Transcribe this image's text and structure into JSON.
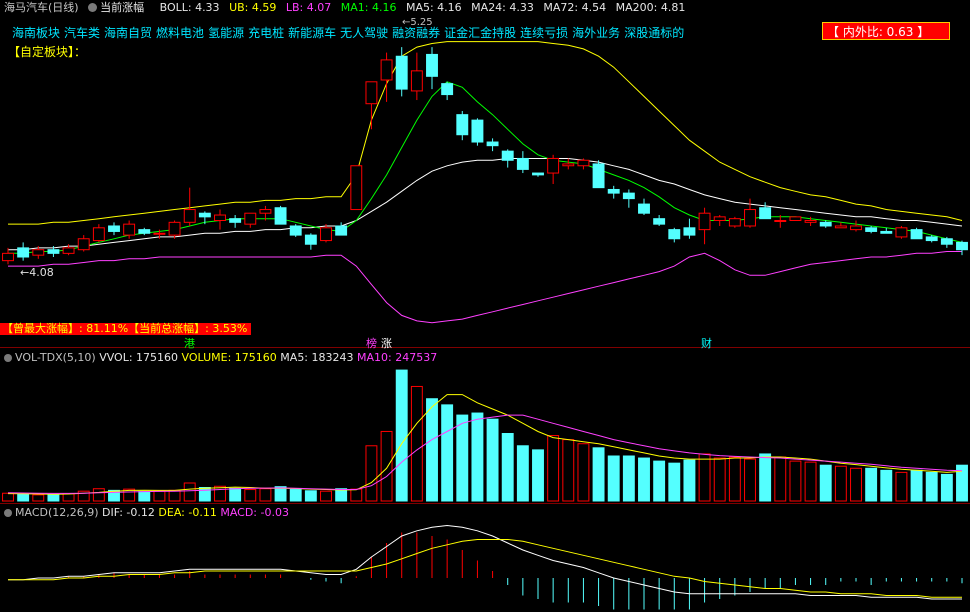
{
  "header": {
    "stock_name": "海马汽车(日线)",
    "indicator_name": "当前涨幅",
    "boll_label": "BOLL: 4.33",
    "ub_label": "UB: 4.59",
    "lb_label": "LB: 4.07",
    "ma1_label": "MA1: 4.16",
    "ma5_label": "MA5: 4.16",
    "ma24_label": "MA24: 4.33",
    "ma72_label": "MA72: 4.54",
    "ma200_label": "MA200: 4.81"
  },
  "concepts": [
    "海南板块",
    "汽车类",
    "海南自贸",
    "燃料电池",
    "氢能源",
    "充电桩",
    "新能源车",
    "无人驾驶",
    "融资融券",
    "证金汇金持股",
    "连续亏损",
    "海外业务",
    "深股通标的"
  ],
  "self_block_label": "【自定板块】：",
  "ratio_box": {
    "label": "【 内外比: 0.63 】"
  },
  "stats_bar": "【曾最大涨幅】: 81.11%【当前总涨幅】: 3.53%",
  "price_high_label": "5.25",
  "price_low_label": "←4.08",
  "events": [
    {
      "label": "港",
      "color": "#00ff00"
    },
    {
      "label": "榜",
      "color": "#ff40ff"
    },
    {
      "label": "涨",
      "color": "#ffffff"
    },
    {
      "label": "财",
      "color": "#00ffff"
    }
  ],
  "volume_header": {
    "title": "VOL-TDX(5,10)",
    "vvol": "VVOL: 175160",
    "volume": "VOLUME: 175160",
    "ma5": "MA5: 183243",
    "ma10": "MA10: 247537"
  },
  "macd_header": {
    "title": "MACD(12,26,9)",
    "dif": "DIF: -0.12",
    "dea": "DEA: -0.11",
    "macd": "MACD: -0.03"
  },
  "colors": {
    "up": "#ff0000",
    "down": "#54ffff",
    "ma_white": "#ffffff",
    "ma_yellow": "#ffff00",
    "ma_green": "#00ff00",
    "ma_magenta": "#ff40ff",
    "grid_red": "#800000"
  },
  "chart_data": [
    {
      "type": "candlestick",
      "title": "海马汽车(日线)",
      "ylim": [
        3.7,
        5.3
      ],
      "high_marker": 5.25,
      "low_marker": 4.08,
      "candles": [
        {
          "o": 4.08,
          "h": 4.15,
          "l": 4.06,
          "c": 4.12
        },
        {
          "o": 4.15,
          "h": 4.18,
          "l": 4.08,
          "c": 4.1
        },
        {
          "o": 4.11,
          "h": 4.16,
          "l": 4.09,
          "c": 4.14
        },
        {
          "o": 4.14,
          "h": 4.16,
          "l": 4.1,
          "c": 4.12
        },
        {
          "o": 4.12,
          "h": 4.17,
          "l": 4.11,
          "c": 4.15
        },
        {
          "o": 4.14,
          "h": 4.22,
          "l": 4.13,
          "c": 4.2
        },
        {
          "o": 4.19,
          "h": 4.28,
          "l": 4.18,
          "c": 4.26
        },
        {
          "o": 4.27,
          "h": 4.29,
          "l": 4.22,
          "c": 4.24
        },
        {
          "o": 4.22,
          "h": 4.3,
          "l": 4.2,
          "c": 4.28
        },
        {
          "o": 4.25,
          "h": 4.26,
          "l": 4.22,
          "c": 4.23
        },
        {
          "o": 4.23,
          "h": 4.25,
          "l": 4.2,
          "c": 4.23
        },
        {
          "o": 4.22,
          "h": 4.3,
          "l": 4.2,
          "c": 4.29
        },
        {
          "o": 4.29,
          "h": 4.48,
          "l": 4.27,
          "c": 4.36
        },
        {
          "o": 4.34,
          "h": 4.35,
          "l": 4.28,
          "c": 4.32
        },
        {
          "o": 4.3,
          "h": 4.36,
          "l": 4.25,
          "c": 4.33
        },
        {
          "o": 4.31,
          "h": 4.33,
          "l": 4.26,
          "c": 4.29
        },
        {
          "o": 4.28,
          "h": 4.34,
          "l": 4.26,
          "c": 4.34
        },
        {
          "o": 4.34,
          "h": 4.38,
          "l": 4.3,
          "c": 4.36
        },
        {
          "o": 4.37,
          "h": 4.38,
          "l": 4.28,
          "c": 4.28
        },
        {
          "o": 4.27,
          "h": 4.28,
          "l": 4.21,
          "c": 4.22
        },
        {
          "o": 4.22,
          "h": 4.23,
          "l": 4.14,
          "c": 4.17
        },
        {
          "o": 4.19,
          "h": 4.28,
          "l": 4.18,
          "c": 4.26
        },
        {
          "o": 4.27,
          "h": 4.29,
          "l": 4.22,
          "c": 4.22
        },
        {
          "o": 4.36,
          "h": 4.6,
          "l": 4.36,
          "c": 4.6
        },
        {
          "o": 4.94,
          "h": 5.06,
          "l": 4.8,
          "c": 5.06
        },
        {
          "o": 5.07,
          "h": 5.22,
          "l": 4.95,
          "c": 5.18
        },
        {
          "o": 5.2,
          "h": 5.25,
          "l": 4.98,
          "c": 5.02
        },
        {
          "o": 5.01,
          "h": 5.22,
          "l": 4.96,
          "c": 5.12
        },
        {
          "o": 5.21,
          "h": 5.25,
          "l": 5.02,
          "c": 5.09
        },
        {
          "o": 5.05,
          "h": 5.06,
          "l": 4.96,
          "c": 4.99
        },
        {
          "o": 4.88,
          "h": 4.9,
          "l": 4.74,
          "c": 4.77
        },
        {
          "o": 4.85,
          "h": 4.86,
          "l": 4.71,
          "c": 4.73
        },
        {
          "o": 4.73,
          "h": 4.75,
          "l": 4.68,
          "c": 4.71
        },
        {
          "o": 4.68,
          "h": 4.69,
          "l": 4.59,
          "c": 4.63
        },
        {
          "o": 4.64,
          "h": 4.68,
          "l": 4.56,
          "c": 4.58
        },
        {
          "o": 4.56,
          "h": 4.56,
          "l": 4.54,
          "c": 4.55
        },
        {
          "o": 4.56,
          "h": 4.66,
          "l": 4.5,
          "c": 4.64
        },
        {
          "o": 4.6,
          "h": 4.64,
          "l": 4.58,
          "c": 4.61
        },
        {
          "o": 4.6,
          "h": 4.64,
          "l": 4.58,
          "c": 4.63
        },
        {
          "o": 4.61,
          "h": 4.63,
          "l": 4.48,
          "c": 4.48
        },
        {
          "o": 4.47,
          "h": 4.49,
          "l": 4.42,
          "c": 4.45
        },
        {
          "o": 4.45,
          "h": 4.47,
          "l": 4.37,
          "c": 4.42
        },
        {
          "o": 4.39,
          "h": 4.42,
          "l": 4.33,
          "c": 4.34
        },
        {
          "o": 4.31,
          "h": 4.33,
          "l": 4.27,
          "c": 4.28
        },
        {
          "o": 4.25,
          "h": 4.26,
          "l": 4.18,
          "c": 4.2
        },
        {
          "o": 4.26,
          "h": 4.31,
          "l": 4.2,
          "c": 4.22
        },
        {
          "o": 4.25,
          "h": 4.37,
          "l": 4.17,
          "c": 4.34
        },
        {
          "o": 4.3,
          "h": 4.33,
          "l": 4.27,
          "c": 4.32
        },
        {
          "o": 4.27,
          "h": 4.32,
          "l": 4.26,
          "c": 4.31
        },
        {
          "o": 4.27,
          "h": 4.42,
          "l": 4.26,
          "c": 4.36
        },
        {
          "o": 4.37,
          "h": 4.4,
          "l": 4.31,
          "c": 4.31
        },
        {
          "o": 4.3,
          "h": 4.33,
          "l": 4.26,
          "c": 4.3
        },
        {
          "o": 4.3,
          "h": 4.32,
          "l": 4.3,
          "c": 4.32
        },
        {
          "o": 4.29,
          "h": 4.32,
          "l": 4.27,
          "c": 4.3
        },
        {
          "o": 4.29,
          "h": 4.3,
          "l": 4.26,
          "c": 4.27
        },
        {
          "o": 4.26,
          "h": 4.29,
          "l": 4.26,
          "c": 4.27
        },
        {
          "o": 4.25,
          "h": 4.3,
          "l": 4.24,
          "c": 4.27
        },
        {
          "o": 4.26,
          "h": 4.27,
          "l": 4.23,
          "c": 4.24
        },
        {
          "o": 4.24,
          "h": 4.26,
          "l": 4.23,
          "c": 4.23
        },
        {
          "o": 4.21,
          "h": 4.27,
          "l": 4.2,
          "c": 4.26
        },
        {
          "o": 4.25,
          "h": 4.26,
          "l": 4.2,
          "c": 4.2
        },
        {
          "o": 4.21,
          "h": 4.22,
          "l": 4.18,
          "c": 4.19
        },
        {
          "o": 4.2,
          "h": 4.21,
          "l": 4.15,
          "c": 4.17
        },
        {
          "o": 4.18,
          "h": 4.19,
          "l": 4.11,
          "c": 4.14
        }
      ],
      "ma_short": [
        4.12,
        4.12,
        4.13,
        4.13,
        4.14,
        4.16,
        4.18,
        4.2,
        4.22,
        4.23,
        4.24,
        4.25,
        4.27,
        4.29,
        4.3,
        4.31,
        4.31,
        4.31,
        4.31,
        4.29,
        4.27,
        4.25,
        4.24,
        4.3,
        4.42,
        4.55,
        4.7,
        4.85,
        4.98,
        5.06,
        5.03,
        4.95,
        4.88,
        4.8,
        4.72,
        4.66,
        4.63,
        4.62,
        4.61,
        4.58,
        4.55,
        4.52,
        4.48,
        4.43,
        4.37,
        4.33,
        4.3,
        4.3,
        4.3,
        4.31,
        4.32,
        4.32,
        4.32,
        4.31,
        4.3,
        4.29,
        4.28,
        4.27,
        4.26,
        4.25,
        4.24,
        4.22,
        4.2,
        4.18
      ],
      "boll_mid": [
        4.14,
        4.14,
        4.15,
        4.15,
        4.16,
        4.16,
        4.17,
        4.18,
        4.19,
        4.2,
        4.21,
        4.21,
        4.22,
        4.23,
        4.23,
        4.24,
        4.24,
        4.25,
        4.25,
        4.26,
        4.26,
        4.27,
        4.27,
        4.3,
        4.35,
        4.4,
        4.46,
        4.52,
        4.57,
        4.6,
        4.62,
        4.63,
        4.63,
        4.64,
        4.64,
        4.64,
        4.64,
        4.64,
        4.63,
        4.62,
        4.6,
        4.58,
        4.55,
        4.52,
        4.5,
        4.47,
        4.44,
        4.42,
        4.4,
        4.39,
        4.38,
        4.37,
        4.36,
        4.35,
        4.34,
        4.33,
        4.32,
        4.32,
        4.31,
        4.3,
        4.3,
        4.29,
        4.28,
        4.27
      ],
      "boll_upper": [
        4.28,
        4.28,
        4.28,
        4.29,
        4.29,
        4.3,
        4.31,
        4.32,
        4.33,
        4.34,
        4.35,
        4.36,
        4.37,
        4.38,
        4.39,
        4.4,
        4.4,
        4.41,
        4.41,
        4.42,
        4.42,
        4.43,
        4.43,
        4.55,
        4.85,
        5.05,
        5.2,
        5.25,
        5.27,
        5.28,
        5.28,
        5.28,
        5.28,
        5.28,
        5.28,
        5.28,
        5.27,
        5.26,
        5.24,
        5.2,
        5.14,
        5.06,
        4.98,
        4.9,
        4.82,
        4.74,
        4.68,
        4.62,
        4.58,
        4.54,
        4.51,
        4.48,
        4.46,
        4.44,
        4.43,
        4.41,
        4.39,
        4.38,
        4.36,
        4.35,
        4.34,
        4.33,
        4.32,
        4.3
      ],
      "boll_lower": [
        4.05,
        4.05,
        4.05,
        4.06,
        4.06,
        4.07,
        4.08,
        4.08,
        4.09,
        4.09,
        4.1,
        4.1,
        4.1,
        4.1,
        4.1,
        4.1,
        4.1,
        4.1,
        4.1,
        4.1,
        4.1,
        4.11,
        4.11,
        4.05,
        3.95,
        3.85,
        3.78,
        3.75,
        3.74,
        3.75,
        3.76,
        3.78,
        3.8,
        3.82,
        3.84,
        3.86,
        3.88,
        3.9,
        3.92,
        3.94,
        3.96,
        3.98,
        4.0,
        4.02,
        4.05,
        4.1,
        4.12,
        4.08,
        4.03,
        4.0,
        4.0,
        4.02,
        4.04,
        4.06,
        4.07,
        4.08,
        4.09,
        4.1,
        4.1,
        4.11,
        4.12,
        4.12,
        4.13,
        4.13
      ]
    },
    {
      "type": "bar",
      "title": "VOL-TDX(5,10)",
      "volumes": [
        38,
        32,
        30,
        30,
        36,
        48,
        60,
        52,
        58,
        46,
        48,
        52,
        88,
        66,
        72,
        62,
        56,
        60,
        70,
        56,
        50,
        48,
        60,
        58,
        270,
        340,
        640,
        560,
        500,
        470,
        420,
        430,
        400,
        330,
        270,
        250,
        320,
        300,
        280,
        260,
        220,
        220,
        210,
        195,
        185,
        200,
        230,
        210,
        215,
        205,
        230,
        215,
        195,
        190,
        175,
        170,
        160,
        160,
        150,
        140,
        150,
        140,
        130,
        175
      ],
      "ma5": [
        36,
        35,
        34,
        33,
        34,
        38,
        42,
        48,
        52,
        53,
        52,
        52,
        58,
        62,
        65,
        68,
        66,
        62,
        62,
        61,
        58,
        56,
        54,
        55,
        90,
        160,
        280,
        380,
        460,
        520,
        520,
        480,
        450,
        420,
        380,
        340,
        310,
        300,
        290,
        280,
        265,
        250,
        235,
        220,
        210,
        205,
        205,
        205,
        210,
        210,
        215,
        215,
        210,
        205,
        195,
        185,
        178,
        170,
        162,
        155,
        150,
        145,
        140,
        145
      ],
      "ma10": [
        40,
        39,
        38,
        37,
        37,
        38,
        40,
        42,
        44,
        46,
        47,
        48,
        50,
        53,
        56,
        60,
        62,
        63,
        64,
        62,
        60,
        58,
        56,
        56,
        75,
        120,
        190,
        250,
        300,
        340,
        380,
        400,
        410,
        420,
        420,
        400,
        380,
        360,
        340,
        320,
        300,
        285,
        270,
        255,
        245,
        235,
        228,
        222,
        218,
        215,
        212,
        210,
        205,
        200,
        195,
        190,
        185,
        180,
        172,
        165,
        160,
        155,
        150,
        148
      ]
    },
    {
      "type": "line",
      "title": "MACD(12,26,9)",
      "dif": [
        -0.01,
        -0.01,
        0.0,
        0.0,
        0.01,
        0.01,
        0.02,
        0.03,
        0.03,
        0.03,
        0.03,
        0.04,
        0.05,
        0.05,
        0.05,
        0.05,
        0.05,
        0.05,
        0.05,
        0.04,
        0.03,
        0.02,
        0.02,
        0.05,
        0.12,
        0.18,
        0.24,
        0.27,
        0.29,
        0.3,
        0.29,
        0.27,
        0.24,
        0.2,
        0.16,
        0.13,
        0.1,
        0.08,
        0.06,
        0.03,
        0.0,
        -0.02,
        -0.04,
        -0.06,
        -0.08,
        -0.09,
        -0.09,
        -0.09,
        -0.09,
        -0.09,
        -0.09,
        -0.09,
        -0.09,
        -0.1,
        -0.1,
        -0.1,
        -0.1,
        -0.11,
        -0.11,
        -0.11,
        -0.11,
        -0.12,
        -0.12,
        -0.12
      ],
      "dea": [
        -0.01,
        -0.01,
        -0.01,
        -0.01,
        0.0,
        0.0,
        0.01,
        0.01,
        0.02,
        0.02,
        0.02,
        0.03,
        0.03,
        0.04,
        0.04,
        0.04,
        0.04,
        0.04,
        0.04,
        0.04,
        0.04,
        0.04,
        0.04,
        0.04,
        0.06,
        0.08,
        0.11,
        0.14,
        0.17,
        0.19,
        0.21,
        0.22,
        0.22,
        0.22,
        0.21,
        0.19,
        0.17,
        0.15,
        0.13,
        0.11,
        0.09,
        0.07,
        0.05,
        0.03,
        0.01,
        0.0,
        -0.02,
        -0.03,
        -0.04,
        -0.05,
        -0.06,
        -0.06,
        -0.07,
        -0.08,
        -0.08,
        -0.09,
        -0.09,
        -0.09,
        -0.1,
        -0.1,
        -0.1,
        -0.11,
        -0.11,
        -0.11
      ],
      "macd": [
        0.0,
        0.0,
        0.0,
        0.0,
        0.01,
        0.01,
        0.02,
        0.03,
        0.02,
        0.02,
        0.02,
        0.02,
        0.04,
        0.02,
        0.02,
        0.02,
        0.02,
        0.02,
        0.02,
        0.0,
        -0.01,
        -0.02,
        -0.03,
        0.01,
        0.12,
        0.2,
        0.26,
        0.26,
        0.24,
        0.22,
        0.16,
        0.1,
        0.04,
        -0.04,
        -0.1,
        -0.12,
        -0.14,
        -0.14,
        -0.14,
        -0.16,
        -0.18,
        -0.18,
        -0.18,
        -0.18,
        -0.18,
        -0.18,
        -0.14,
        -0.12,
        -0.1,
        -0.08,
        -0.06,
        -0.06,
        -0.04,
        -0.04,
        -0.04,
        -0.02,
        -0.02,
        -0.04,
        -0.02,
        -0.02,
        -0.02,
        -0.02,
        -0.02,
        -0.03
      ]
    }
  ]
}
